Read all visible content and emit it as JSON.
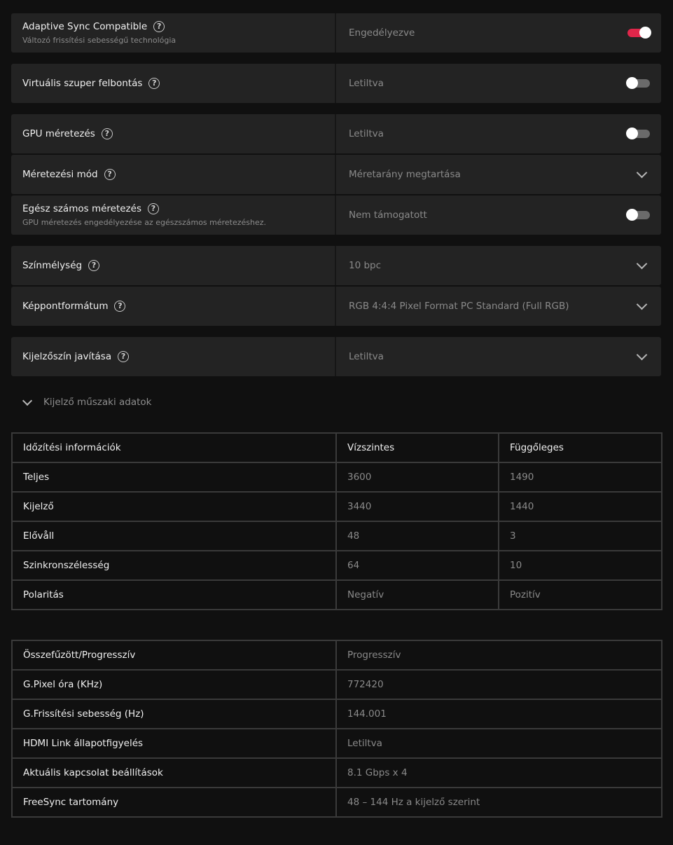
{
  "settings": {
    "adaptive_sync": {
      "label": "Adaptive Sync Compatible",
      "sub": "Változó frissítési sebességű technológia",
      "value": "Engedélyezve",
      "toggle": "on"
    },
    "vsr": {
      "label": "Virtuális szuper felbontás",
      "value": "Letiltva",
      "toggle": "off"
    },
    "gpu_scaling": {
      "label": "GPU méretezés",
      "value": "Letiltva",
      "toggle": "off"
    },
    "scaling_mode": {
      "label": "Méretezési mód",
      "value": "Méretarány megtartása"
    },
    "integer_scaling": {
      "label": "Egész számos méretezés",
      "sub": "GPU méretezés engedélyezése az egészszámos méretezéshez.",
      "value": "Nem támogatott",
      "toggle": "off"
    },
    "color_depth": {
      "label": "Színmélység",
      "value": "10 bpc"
    },
    "pixel_format": {
      "label": "Képpontformátum",
      "value": "RGB 4:4:4 Pixel Format PC Standard (Full RGB)"
    },
    "color_enhancement": {
      "label": "Kijelzőszín javítása",
      "value": "Letiltva"
    }
  },
  "help_glyph": "?",
  "spec_toggle_label": "Kijelző műszaki adatok",
  "timing": {
    "headers": [
      "Időzítési információk",
      "Vízszintes",
      "Függőleges"
    ],
    "rows": [
      [
        "Teljes",
        "3600",
        "1490"
      ],
      [
        "Kijelző",
        "3440",
        "1440"
      ],
      [
        "Elővåll",
        "48",
        "3"
      ],
      [
        "Szinkronszélesség",
        "64",
        "10"
      ],
      [
        "Polaritás",
        "Negatív",
        "Pozitív"
      ]
    ]
  },
  "info": {
    "rows": [
      [
        "Összefűzött/Progresszív",
        "Progresszív"
      ],
      [
        "G.Pixel óra (KHz)",
        "772420"
      ],
      [
        "G.Frissítési sebesség (Hz)",
        "144.001"
      ],
      [
        "HDMI Link állapotfigyelés",
        "Letiltva"
      ],
      [
        "Aktuális kapcsolat beállítások",
        "8.1 Gbps x 4"
      ],
      [
        "FreeSync tartomány",
        "48 – 144 Hz a kijelző szerint"
      ]
    ]
  },
  "colors": {
    "accent": "#e0264a",
    "row_bg": "#232323",
    "page_bg": "#101010"
  }
}
